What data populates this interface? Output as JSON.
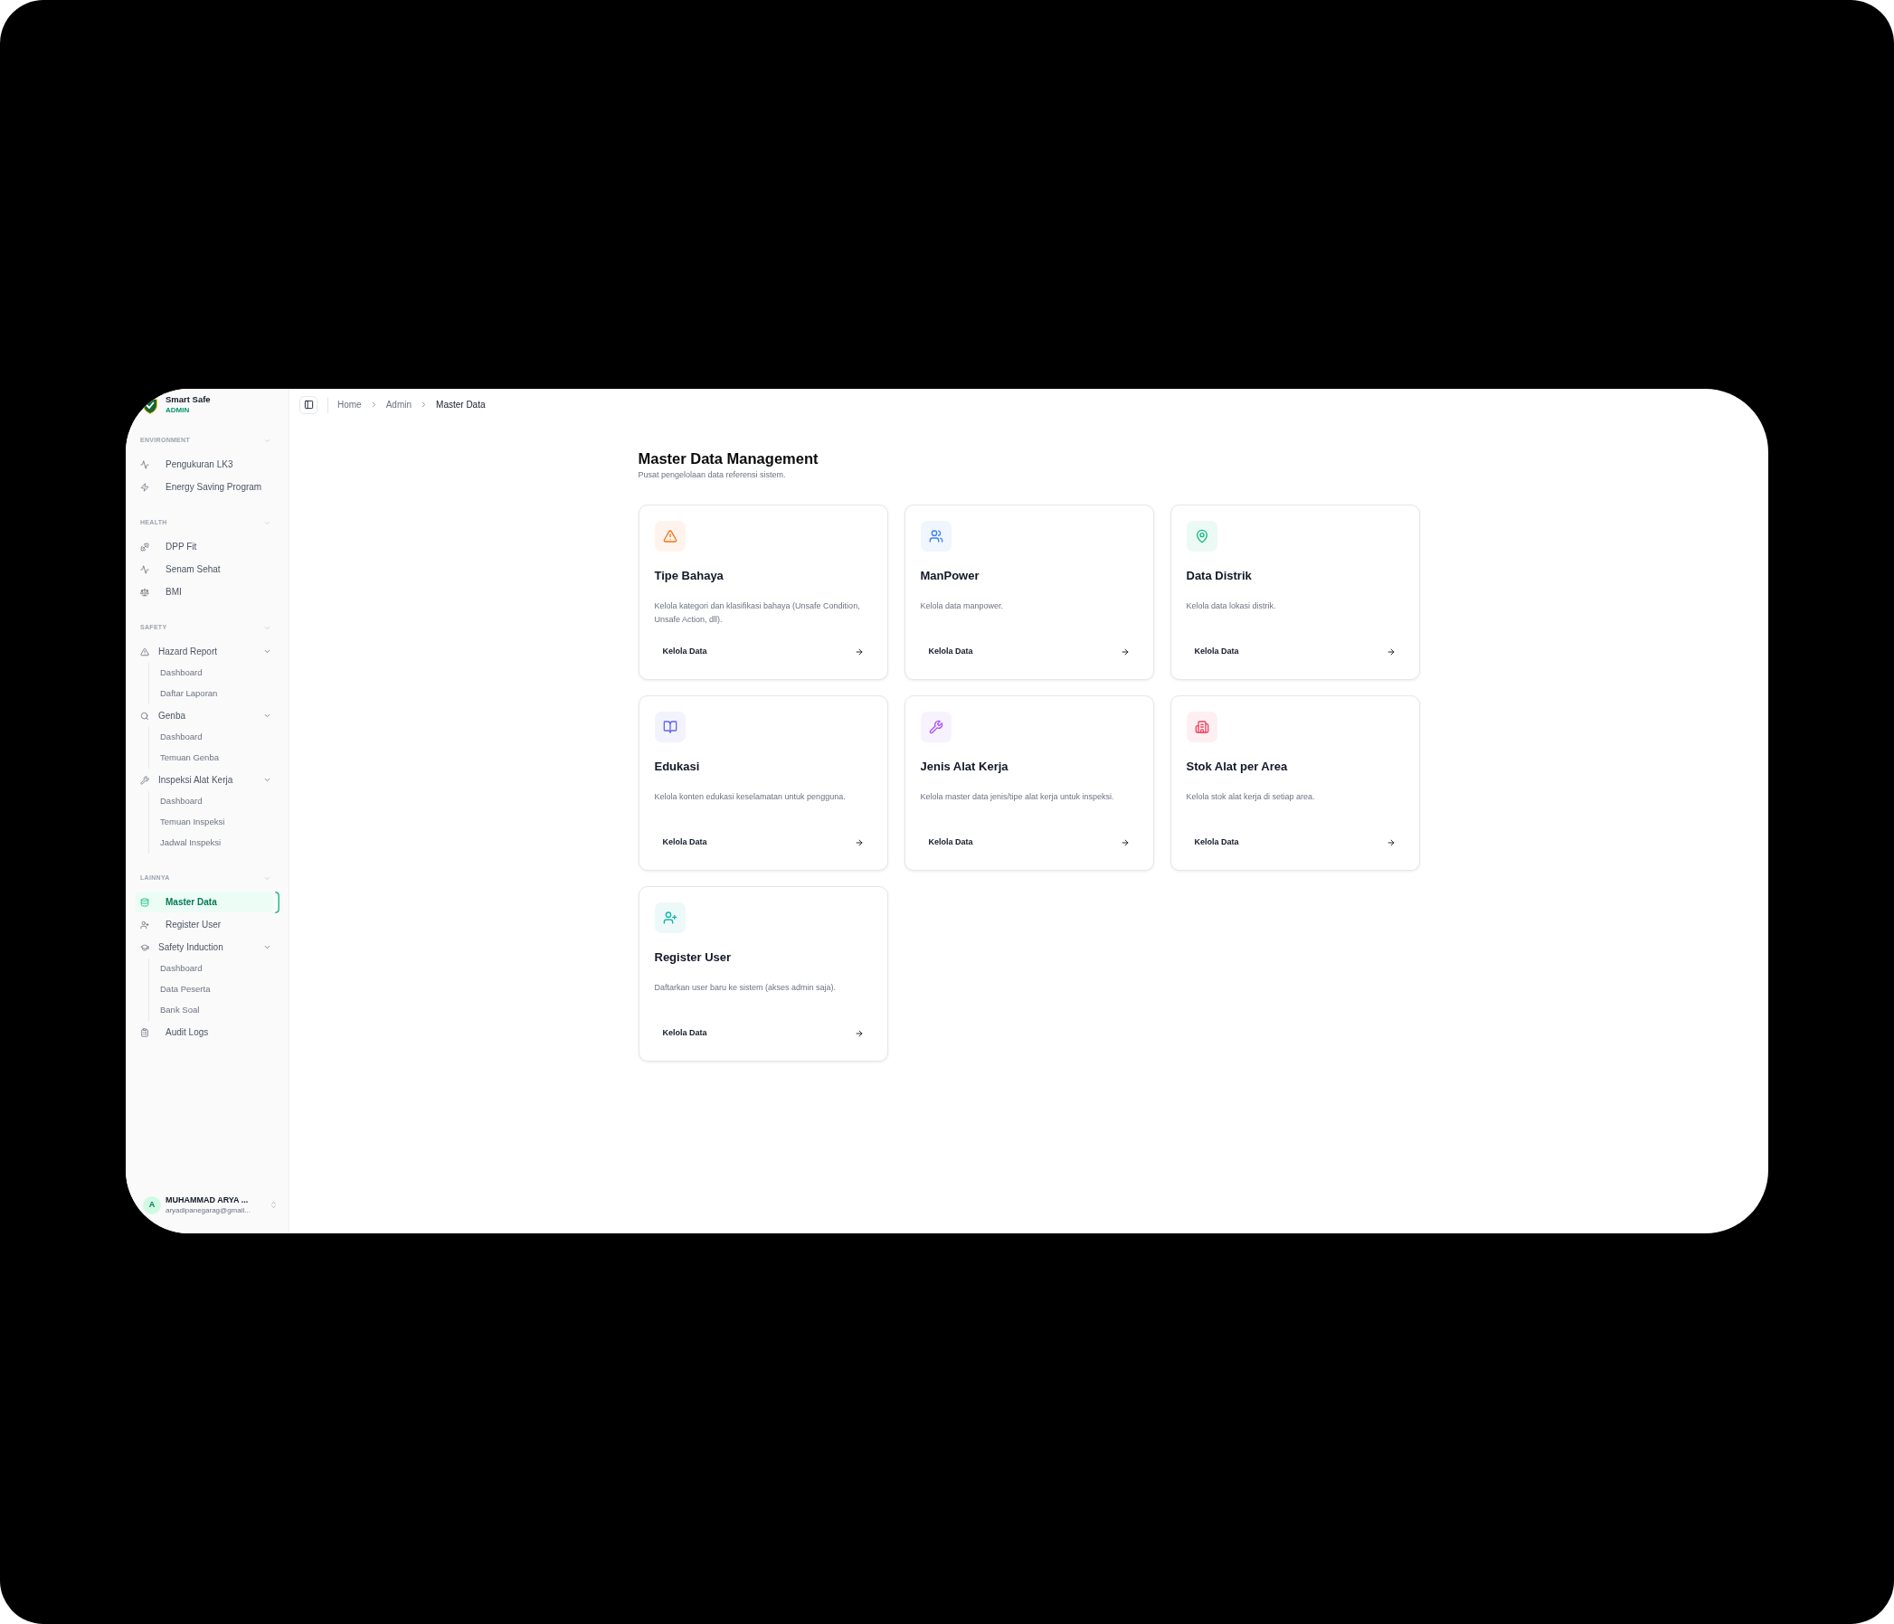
{
  "app": {
    "name": "Smart Safe",
    "role": "ADMIN"
  },
  "sidebar": {
    "sections": [
      {
        "title": "ENVIRONMENT",
        "expanded": true,
        "items": [
          {
            "label": "Pengukuran LK3",
            "selected": false
          },
          {
            "label": "Energy Saving Program",
            "selected": false
          }
        ]
      },
      {
        "title": "HEALTH",
        "expanded": true,
        "items": [
          {
            "label": "DPP Fit",
            "selected": false
          },
          {
            "label": "Senam Sehat",
            "selected": false
          },
          {
            "label": "BMI",
            "selected": false
          }
        ]
      },
      {
        "title": "SAFETY",
        "expanded": true,
        "items": [
          {
            "label": "Hazard Report",
            "selected": false,
            "expanded": true,
            "children": [
              {
                "label": "Dashboard",
                "selected": false
              },
              {
                "label": "Daftar Laporan",
                "selected": false
              }
            ]
          },
          {
            "label": "Genba",
            "selected": false,
            "expanded": true,
            "children": [
              {
                "label": "Dashboard",
                "selected": false
              },
              {
                "label": "Temuan Genba",
                "selected": false
              }
            ]
          },
          {
            "label": "Inspeksi Alat Kerja",
            "selected": false,
            "expanded": true,
            "children": [
              {
                "label": "Dashboard",
                "selected": false
              },
              {
                "label": "Temuan Inspeksi",
                "selected": false
              },
              {
                "label": "Jadwal Inspeksi",
                "selected": false
              }
            ]
          }
        ]
      },
      {
        "title": "LAINNYA",
        "expanded": true,
        "items": [
          {
            "label": "Master Data",
            "selected": true
          },
          {
            "label": "Register User",
            "selected": false
          },
          {
            "label": "Safety Induction",
            "selected": false,
            "expanded": true,
            "children": [
              {
                "label": "Dashboard",
                "selected": false
              },
              {
                "label": "Data Peserta",
                "selected": false
              },
              {
                "label": "Bank Soal",
                "selected": false
              }
            ]
          },
          {
            "label": "Audit Logs",
            "selected": false
          }
        ]
      }
    ]
  },
  "user": {
    "initial": "A",
    "name": "MUHAMMAD ARYA ...",
    "email": "aryadipanegarag@gmail..."
  },
  "breadcrumb": [
    {
      "label": "Home",
      "current": false
    },
    {
      "label": "Admin",
      "current": false
    },
    {
      "label": "Master Data",
      "current": true
    }
  ],
  "page": {
    "title": "Master Data Management",
    "subtitle": "Pusat pengelolaan data referensi sistem."
  },
  "cards": [
    {
      "title": "Tipe Bahaya",
      "description": "Kelola kategori dan klasifikasi bahaya (Unsafe Condition, Unsafe Action, dll).",
      "action": "Kelola Data",
      "color": "#f97316"
    },
    {
      "title": "ManPower",
      "description": "Kelola data manpower.",
      "action": "Kelola Data",
      "color": "#3b82f6"
    },
    {
      "title": "Data Distrik",
      "description": "Kelola data lokasi distrik.",
      "action": "Kelola Data",
      "color": "#10b981"
    },
    {
      "title": "Edukasi",
      "description": "Kelola konten edukasi keselamatan untuk pengguna.",
      "action": "Kelola Data",
      "color": "#6366f1"
    },
    {
      "title": "Jenis Alat Kerja",
      "description": "Kelola master data jenis/tipe alat kerja untuk inspeksi.",
      "action": "Kelola Data",
      "color": "#a855f7"
    },
    {
      "title": "Stok Alat per Area",
      "description": "Kelola stok alat kerja di setiap area.",
      "action": "Kelola Data",
      "color": "#f43f5e"
    },
    {
      "title": "Register User",
      "description": "Daftarkan user baru ke sistem (akses admin saja).",
      "action": "Kelola Data",
      "color": "#14b8a6"
    }
  ]
}
